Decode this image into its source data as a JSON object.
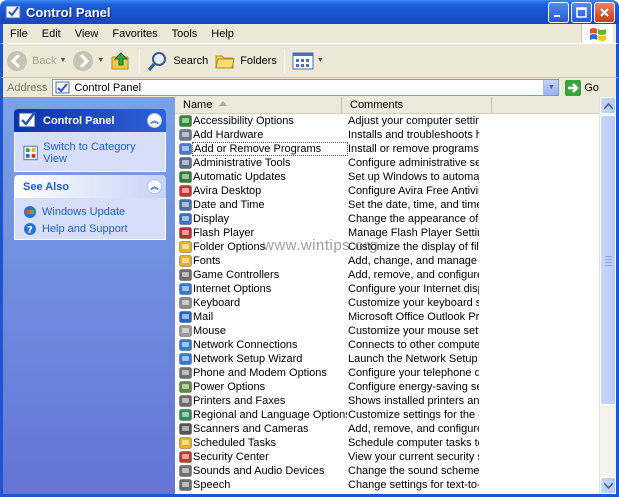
{
  "window": {
    "title": "Control Panel"
  },
  "menu": [
    "File",
    "Edit",
    "View",
    "Favorites",
    "Tools",
    "Help"
  ],
  "toolbar": {
    "back": "Back",
    "search": "Search",
    "folders": "Folders"
  },
  "address": {
    "label": "Address",
    "value": "Control Panel",
    "go": "Go"
  },
  "taskpane": {
    "control_panel": {
      "title": "Control Panel",
      "link": "Switch to Category View"
    },
    "see_also": {
      "title": "See Also",
      "links": [
        "Windows Update",
        "Help and Support"
      ]
    }
  },
  "columns": {
    "name": "Name",
    "comments": "Comments"
  },
  "watermark": "www.wintips.org",
  "items": [
    {
      "name": "Accessibility Options",
      "comment": "Adjust your computer settings...",
      "icon": "accessibility-icon",
      "color": "#2e8b2e"
    },
    {
      "name": "Add Hardware",
      "comment": "Installs and troubleshoots har...",
      "icon": "hardware-icon",
      "color": "#6c7a89"
    },
    {
      "name": "Add or Remove Programs",
      "comment": "Install or remove programs an...",
      "icon": "programs-icon",
      "color": "#4a7bd0"
    },
    {
      "name": "Administrative Tools",
      "comment": "Configure administrative setti...",
      "icon": "admin-tools-icon",
      "color": "#5b6f8a"
    },
    {
      "name": "Automatic Updates",
      "comment": "Set up Windows to automatic...",
      "icon": "updates-icon",
      "color": "#2e7d32"
    },
    {
      "name": "Avira Desktop",
      "comment": "Configure Avira Free Antivirus",
      "icon": "avira-icon",
      "color": "#d32f2f"
    },
    {
      "name": "Date and Time",
      "comment": "Set the date, time, and time z...",
      "icon": "clock-icon",
      "color": "#4a6fa5"
    },
    {
      "name": "Display",
      "comment": "Change the appearance of yo...",
      "icon": "display-icon",
      "color": "#3c6fc4"
    },
    {
      "name": "Flash Player",
      "comment": "Manage Flash Player Settings",
      "icon": "flash-icon",
      "color": "#c62828"
    },
    {
      "name": "Folder Options",
      "comment": "Customize the display of files ...",
      "icon": "folder-icon",
      "color": "#e6b422"
    },
    {
      "name": "Fonts",
      "comment": "Add, change, and manage fo...",
      "icon": "fonts-icon",
      "color": "#e6b422"
    },
    {
      "name": "Game Controllers",
      "comment": "Add, remove, and configure g...",
      "icon": "gamepad-icon",
      "color": "#6d6d6d"
    },
    {
      "name": "Internet Options",
      "comment": "Configure your Internet displa...",
      "icon": "internet-icon",
      "color": "#2a7bd8"
    },
    {
      "name": "Keyboard",
      "comment": "Customize your keyboard sett...",
      "icon": "keyboard-icon",
      "color": "#8a8a8a"
    },
    {
      "name": "Mail",
      "comment": "Microsoft Office Outlook Profiles",
      "icon": "mail-icon",
      "color": "#2a64c5"
    },
    {
      "name": "Mouse",
      "comment": "Customize your mouse setting...",
      "icon": "mouse-icon",
      "color": "#9a9a9a"
    },
    {
      "name": "Network Connections",
      "comment": "Connects to other computers,...",
      "icon": "network-icon",
      "color": "#2f7bd1"
    },
    {
      "name": "Network Setup Wizard",
      "comment": "Launch the Network Setup Wi...",
      "icon": "network-wizard-icon",
      "color": "#2f7bd1"
    },
    {
      "name": "Phone and Modem Options",
      "comment": "Configure your telephone diali...",
      "icon": "phone-icon",
      "color": "#707070"
    },
    {
      "name": "Power Options",
      "comment": "Configure energy-saving setti...",
      "icon": "power-icon",
      "color": "#5a8a3a"
    },
    {
      "name": "Printers and Faxes",
      "comment": "Shows installed printers and f...",
      "icon": "printer-icon",
      "color": "#6b6b6b"
    },
    {
      "name": "Regional and Language Options",
      "comment": "Customize settings for the dis...",
      "icon": "globe-icon",
      "color": "#2e8b57"
    },
    {
      "name": "Scanners and Cameras",
      "comment": "Add, remove, and configure s...",
      "icon": "camera-icon",
      "color": "#555555"
    },
    {
      "name": "Scheduled Tasks",
      "comment": "Schedule computer tasks to ru...",
      "icon": "tasks-icon",
      "color": "#e6b422"
    },
    {
      "name": "Security Center",
      "comment": "View your current security sta...",
      "icon": "shield-icon",
      "color": "#c0392b"
    },
    {
      "name": "Sounds and Audio Devices",
      "comment": "Change the sound scheme for...",
      "icon": "speaker-icon",
      "color": "#707070"
    },
    {
      "name": "Speech",
      "comment": "Change settings for text-to-s...",
      "icon": "speech-icon",
      "color": "#6b6b6b"
    }
  ]
}
